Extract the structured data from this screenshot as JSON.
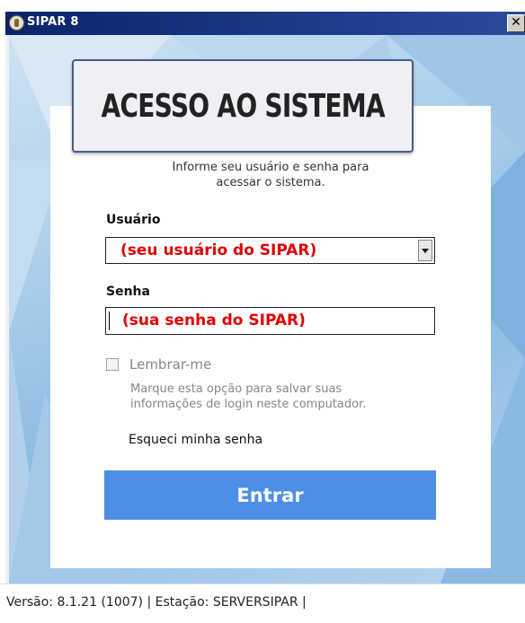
{
  "window": {
    "title": "SIPAR 8",
    "close_label": "✕"
  },
  "login": {
    "heading": "ACESSO AO SISTEMA",
    "instructions_line1": "Informe seu usuário e senha para",
    "instructions_line2": "acessar o sistema.",
    "user_label": "Usuário",
    "user_value": "(seu usuário do SIPAR)",
    "password_label": "Senha",
    "password_value": "(sua senha do SIPAR)",
    "remember_label": "Lembrar-me",
    "remember_checked": false,
    "remember_hint_line1": "Marque esta opção para salvar suas",
    "remember_hint_line2": "informações de login neste computador.",
    "forgot_label": "Esqueci minha senha",
    "submit_label": "Entrar"
  },
  "status": {
    "text": "Versão: 8.1.21 (1007)  |  Estação: SERVERSIPAR  |"
  },
  "colors": {
    "accent": "#4d8fe6",
    "annotation": "#e00000",
    "titlebar": "#0a246a"
  }
}
